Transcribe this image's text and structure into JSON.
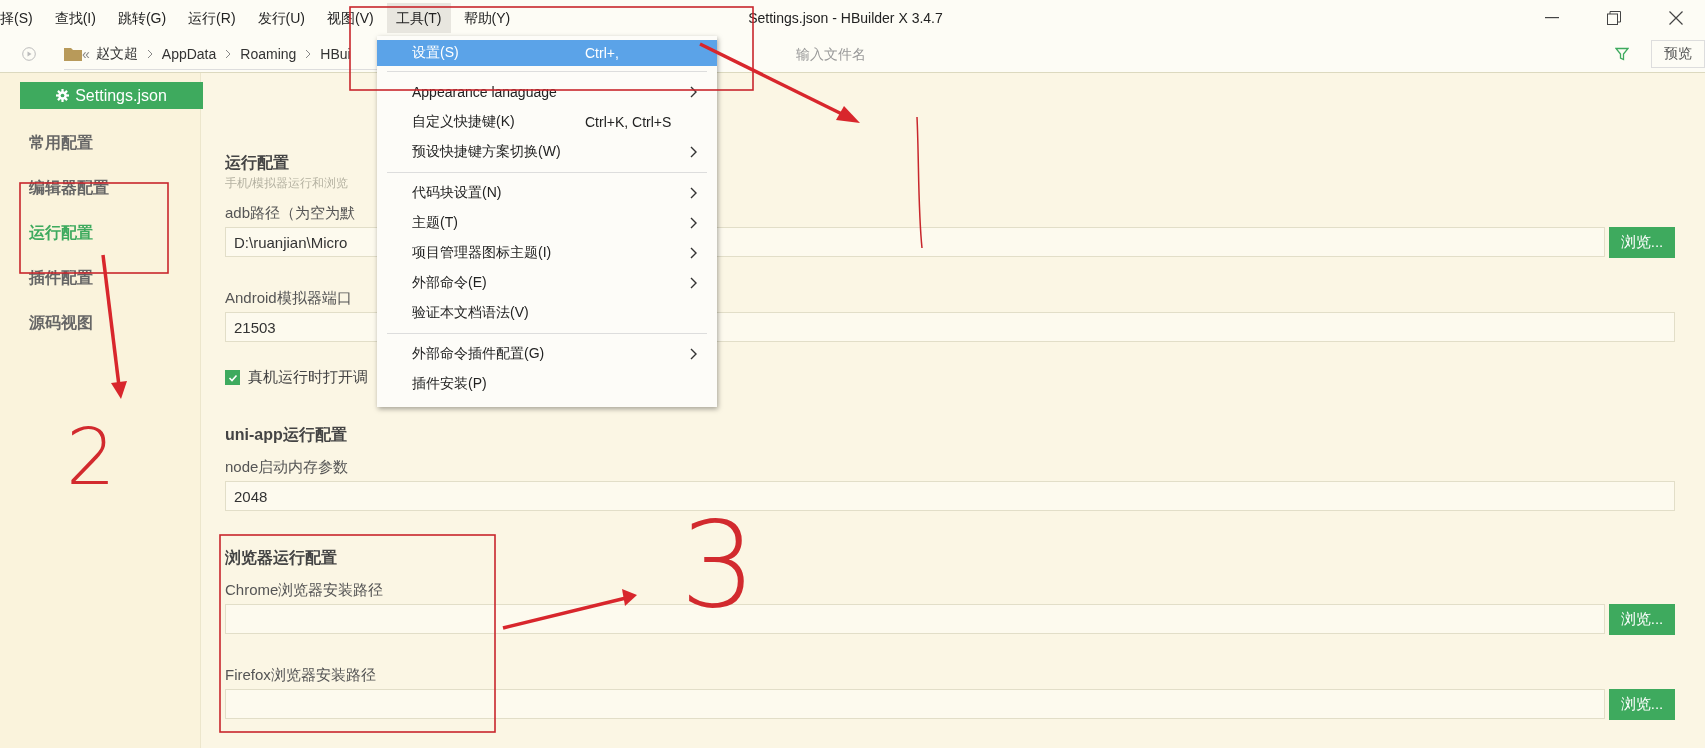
{
  "menu_bar": [
    {
      "label": "择(S)",
      "selected": false
    },
    {
      "label": "查找(I)",
      "selected": false
    },
    {
      "label": "跳转(G)",
      "selected": false
    },
    {
      "label": "运行(R)",
      "selected": false
    },
    {
      "label": "发行(U)",
      "selected": false
    },
    {
      "label": "视图(V)",
      "selected": false
    },
    {
      "label": "工具(T)",
      "selected": true
    },
    {
      "label": "帮助(Y)",
      "selected": false
    }
  ],
  "window": {
    "title": "Settings.json - HBuilder X 3.4.7"
  },
  "path_bar": {
    "back": "«",
    "crumbs": [
      "赵文超",
      "AppData",
      "Roaming",
      "HBui"
    ],
    "search": {
      "placeholder": "输入文件名"
    },
    "preview_button": "预览"
  },
  "file_tab": {
    "label": "Settings.json"
  },
  "sidebar": {
    "items": [
      {
        "label": "常用配置",
        "selected": false
      },
      {
        "label": "编辑器配置",
        "selected": false
      },
      {
        "label": "运行配置",
        "selected": true
      },
      {
        "label": "插件配置",
        "selected": false
      },
      {
        "label": "源码视图",
        "selected": false
      }
    ]
  },
  "sections": [
    {
      "title": "运行配置",
      "subtitle": "手机/模拟器运行和浏览",
      "fields": [
        {
          "kind": "text",
          "label": "adb路径（为空为默",
          "value": "D:\\ruanjian\\Micro",
          "button": "浏览..."
        },
        {
          "kind": "text",
          "label": "Android模拟器端口",
          "value": "21503"
        },
        {
          "kind": "checkbox",
          "label": "真机运行时打开调",
          "checked": true
        }
      ]
    },
    {
      "title": "uni-app运行配置",
      "fields": [
        {
          "kind": "text",
          "label": "node启动内存参数",
          "value": "2048"
        }
      ]
    },
    {
      "title": "浏览器运行配置",
      "fields": [
        {
          "kind": "text",
          "label": "Chrome浏览器安装路径",
          "button": "浏览..."
        },
        {
          "kind": "text",
          "label": "Firefox浏览器安装路径",
          "button": "浏览..."
        }
      ]
    }
  ],
  "tools_menu": {
    "items": [
      {
        "kind": "item",
        "label": "设置(S)",
        "shortcut": "Ctrl+,",
        "submenu": false,
        "selected": true
      },
      {
        "kind": "separator"
      },
      {
        "kind": "item",
        "label": "Appearance lanaguage",
        "submenu": true,
        "selected": false
      },
      {
        "kind": "item",
        "label": "自定义快捷键(K)",
        "shortcut": "Ctrl+K, Ctrl+S",
        "submenu": false,
        "selected": false
      },
      {
        "kind": "item",
        "label": "预设快捷键方案切换(W)",
        "submenu": true,
        "selected": false
      },
      {
        "kind": "separator"
      },
      {
        "kind": "item",
        "label": "代码块设置(N)",
        "submenu": true,
        "selected": false
      },
      {
        "kind": "item",
        "label": "主题(T)",
        "submenu": true,
        "selected": false
      },
      {
        "kind": "item",
        "label": "项目管理器图标主题(I)",
        "submenu": true,
        "selected": false
      },
      {
        "kind": "item",
        "label": "外部命令(E)",
        "submenu": true,
        "selected": false
      },
      {
        "kind": "item",
        "label": "验证本文档语法(V)",
        "submenu": false,
        "selected": false
      },
      {
        "kind": "separator"
      },
      {
        "kind": "item",
        "label": "外部命令插件配置(G)",
        "submenu": true,
        "selected": false
      },
      {
        "kind": "item",
        "label": "插件安装(P)",
        "submenu": false,
        "selected": false
      }
    ]
  },
  "annotations": {
    "numbers": [
      "2",
      "3"
    ]
  }
}
